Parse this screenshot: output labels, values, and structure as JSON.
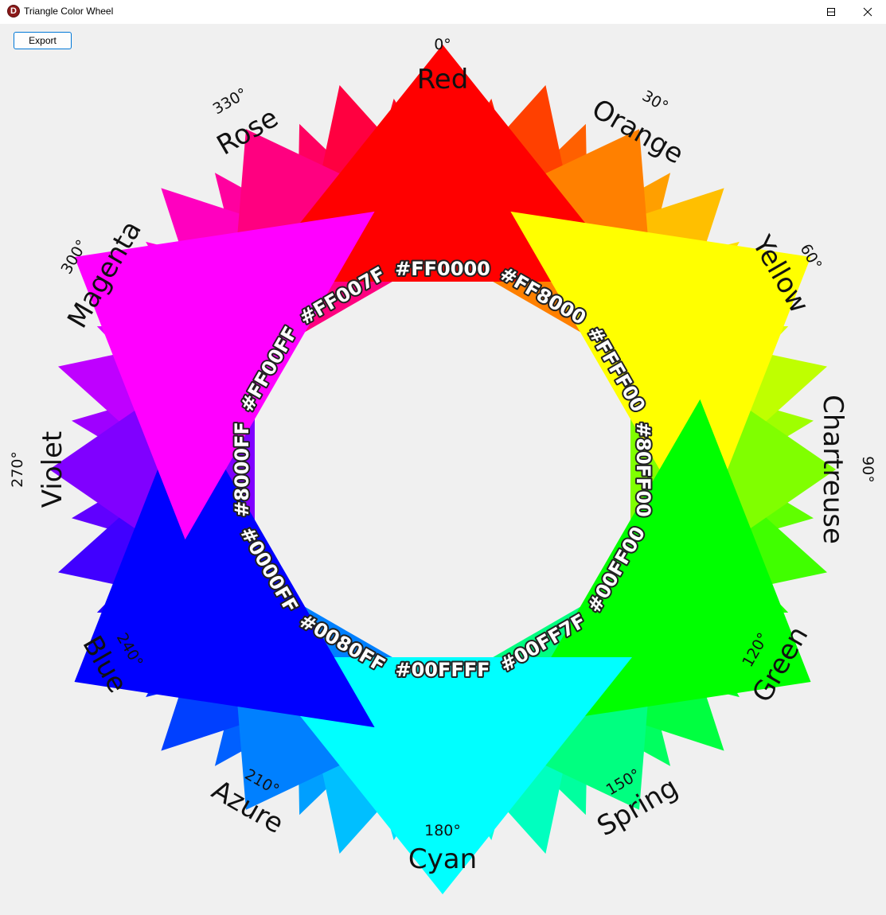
{
  "window": {
    "title": "Triangle Color Wheel",
    "app_icon_letter": "D"
  },
  "toolbar": {
    "export_label": "Export"
  },
  "wheel": {
    "background": "#f0f0f0",
    "main_hues": [
      {
        "angle": 0,
        "name": "Red",
        "degree": "0°",
        "hex": "#FF0000"
      },
      {
        "angle": 30,
        "name": "Orange",
        "degree": "30°",
        "hex": "#FF8000"
      },
      {
        "angle": 60,
        "name": "Yellow",
        "degree": "60°",
        "hex": "#FFFF00"
      },
      {
        "angle": 90,
        "name": "Chartreuse",
        "degree": "90°",
        "hex": "#80FF00"
      },
      {
        "angle": 120,
        "name": "Green",
        "degree": "120°",
        "hex": "#00FF00"
      },
      {
        "angle": 150,
        "name": "Spring",
        "degree": "150°",
        "hex": "#00FF7F"
      },
      {
        "angle": 180,
        "name": "Cyan",
        "degree": "180°",
        "hex": "#00FFFF"
      },
      {
        "angle": 210,
        "name": "Azure",
        "degree": "210°",
        "hex": "#0080FF"
      },
      {
        "angle": 240,
        "name": "Blue",
        "degree": "240°",
        "hex": "#0000FF"
      },
      {
        "angle": 270,
        "name": "Violet",
        "degree": "270°",
        "hex": "#8000FF"
      },
      {
        "angle": 300,
        "name": "Magenta",
        "degree": "300°",
        "hex": "#FF00FF"
      },
      {
        "angle": 330,
        "name": "Rose",
        "degree": "330°",
        "hex": "#FF007F"
      }
    ],
    "minor_hue_step_degrees": 7.5
  }
}
